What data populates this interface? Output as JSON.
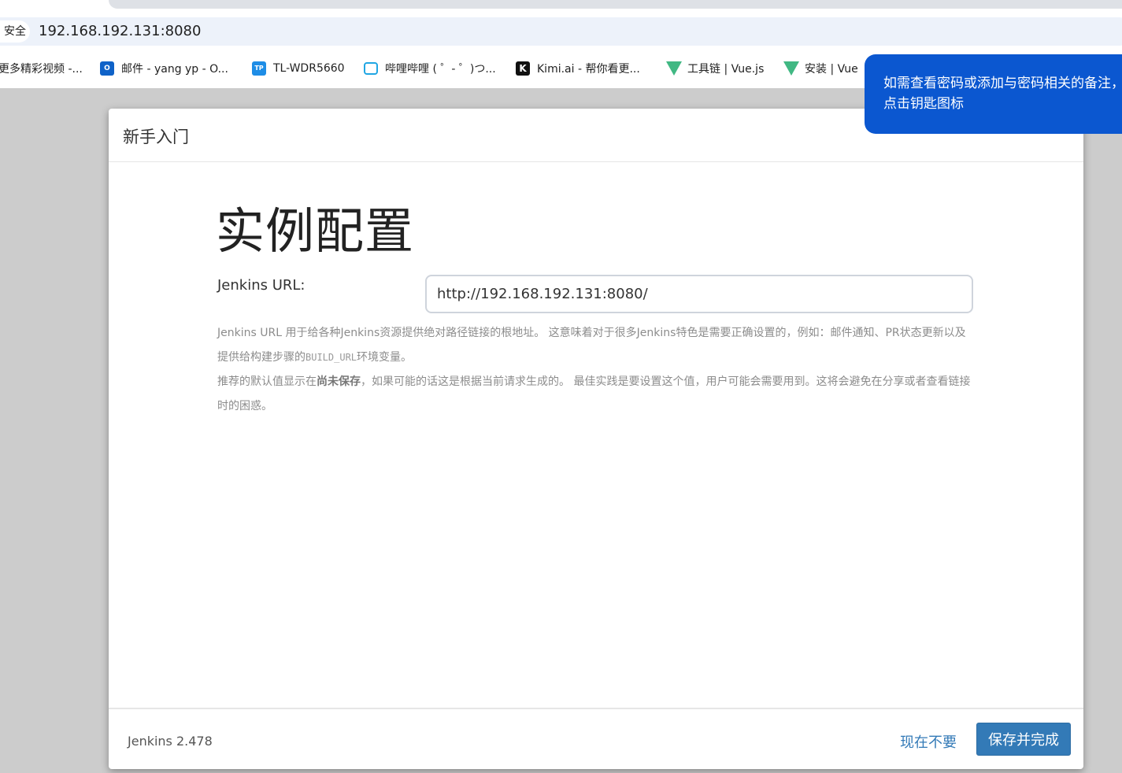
{
  "browser": {
    "security_label": "安全",
    "url": "192.168.192.131:8080",
    "bookmarks": [
      {
        "label": "更多精彩视频 -...",
        "icon": "none"
      },
      {
        "label": "邮件 - yang yp - O...",
        "icon": "outlook-icon",
        "icon_text": "O"
      },
      {
        "label": "TL-WDR5660",
        "icon": "tplink-icon",
        "icon_text": "TP"
      },
      {
        "label": "哔哩哔哩 ( ゜- ゜)つ...",
        "icon": "bilibili-icon"
      },
      {
        "label": "Kimi.ai - 帮你看更...",
        "icon": "kimi-icon",
        "icon_text": "K"
      },
      {
        "label": "工具链 | Vue.js",
        "icon": "vue-icon"
      },
      {
        "label": "安装 | Vue",
        "icon": "vue-icon"
      }
    ]
  },
  "tooltip": {
    "line1": "如需查看密码或添加与密码相关的备注，",
    "line2": "点击钥匙图标"
  },
  "dialog": {
    "title": "新手入门",
    "heading": "实例配置",
    "field_label": "Jenkins URL:",
    "url_value": "http://192.168.192.131:8080/",
    "help_1a": "Jenkins URL 用于给各种Jenkins资源提供绝对路径链接的根地址。 这意味着对于很多Jenkins特色是需要正确设置的，例如：邮件通知、PR状态更新以及提供给构建步骤的",
    "help_1_code": "BUILD_URL",
    "help_1b": "环境变量。",
    "help_2a": "推荐的默认值显示在",
    "help_2_bold": "尚未保存",
    "help_2b": "，如果可能的话这是根据当前请求生成的。 最佳实践是要设置这个值，用户可能会需要用到。这将会避免在分享或者查看链接时的困惑。",
    "version": "Jenkins 2.478",
    "skip_label": "现在不要",
    "save_label": "保存并完成"
  },
  "colors": {
    "primary_button": "#337ab7",
    "link": "#337ab7",
    "tooltip_bg": "#0b57d0",
    "page_backdrop": "#cccccc"
  }
}
